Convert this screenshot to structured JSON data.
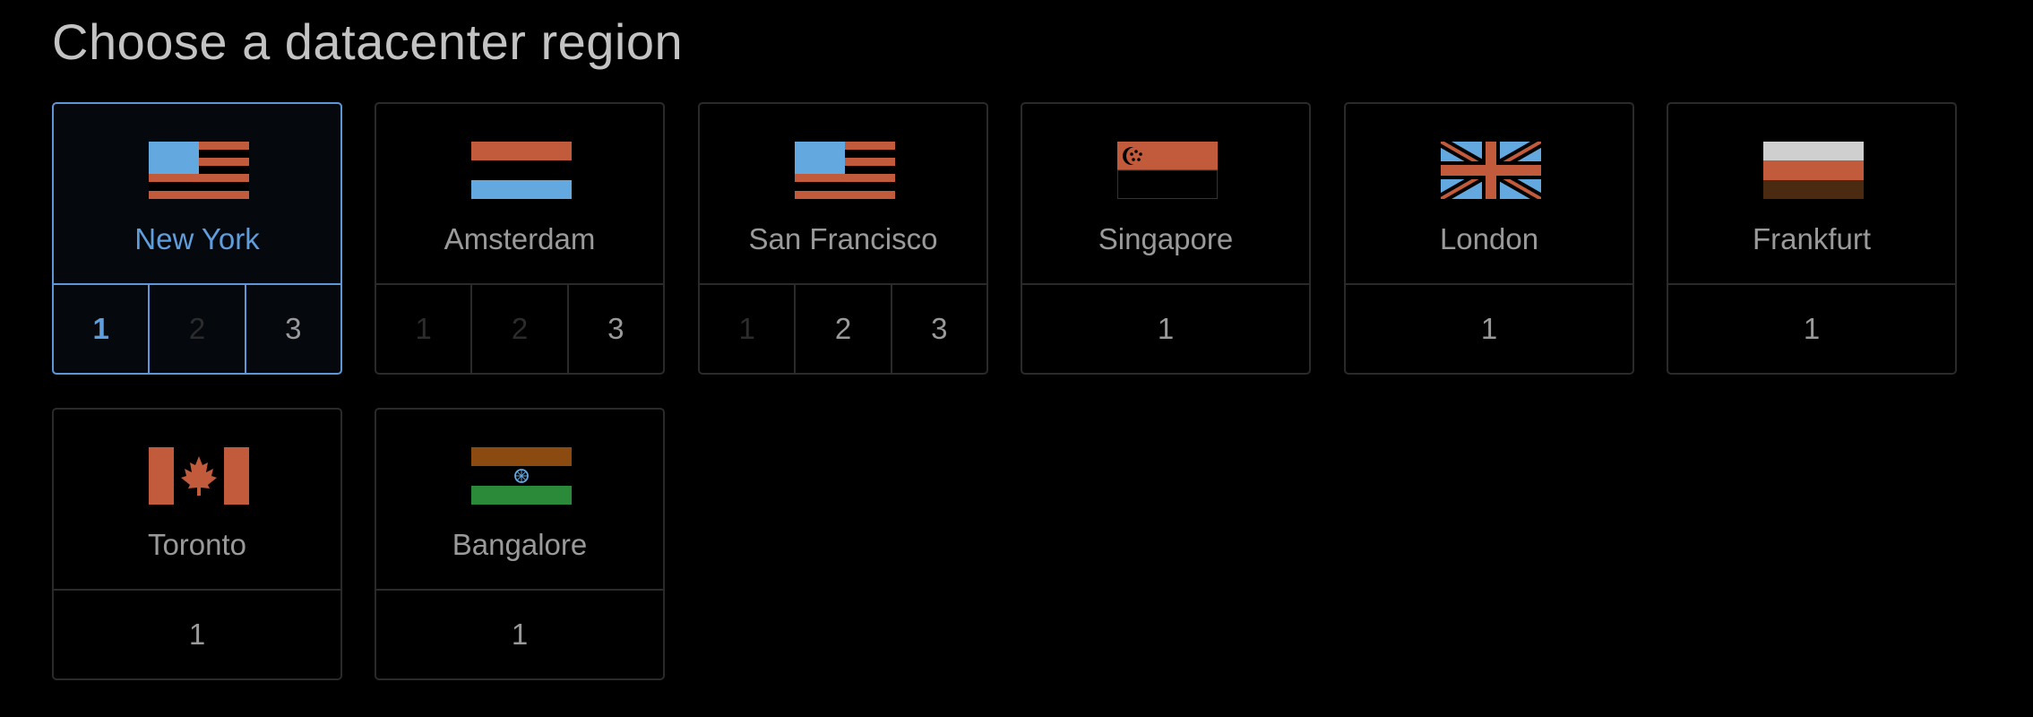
{
  "page_title": "Choose a datacenter region",
  "colors": {
    "background": "#000000",
    "accent": "#5f9edc",
    "card_border": "#2a2a2a",
    "text": "#9a9a9a",
    "disabled_text": "#2c2c2c"
  },
  "regions": [
    {
      "name": "New York",
      "flag": "us-flag-icon",
      "selected": true,
      "datacenters": [
        {
          "label": "1",
          "state": "active"
        },
        {
          "label": "2",
          "state": "disabled"
        },
        {
          "label": "3",
          "state": "available"
        }
      ]
    },
    {
      "name": "Amsterdam",
      "flag": "netherlands-flag-icon",
      "selected": false,
      "datacenters": [
        {
          "label": "1",
          "state": "disabled"
        },
        {
          "label": "2",
          "state": "disabled"
        },
        {
          "label": "3",
          "state": "available"
        }
      ]
    },
    {
      "name": "San Francisco",
      "flag": "us-flag-icon",
      "selected": false,
      "datacenters": [
        {
          "label": "1",
          "state": "disabled"
        },
        {
          "label": "2",
          "state": "available"
        },
        {
          "label": "3",
          "state": "available"
        }
      ]
    },
    {
      "name": "Singapore",
      "flag": "singapore-flag-icon",
      "selected": false,
      "datacenters": [
        {
          "label": "1",
          "state": "available"
        }
      ]
    },
    {
      "name": "London",
      "flag": "uk-flag-icon",
      "selected": false,
      "datacenters": [
        {
          "label": "1",
          "state": "available"
        }
      ]
    },
    {
      "name": "Frankfurt",
      "flag": "germany-flag-icon",
      "selected": false,
      "datacenters": [
        {
          "label": "1",
          "state": "available"
        }
      ]
    },
    {
      "name": "Toronto",
      "flag": "canada-flag-icon",
      "selected": false,
      "datacenters": [
        {
          "label": "1",
          "state": "available"
        }
      ]
    },
    {
      "name": "Bangalore",
      "flag": "india-flag-icon",
      "selected": false,
      "datacenters": [
        {
          "label": "1",
          "state": "available"
        }
      ]
    }
  ]
}
